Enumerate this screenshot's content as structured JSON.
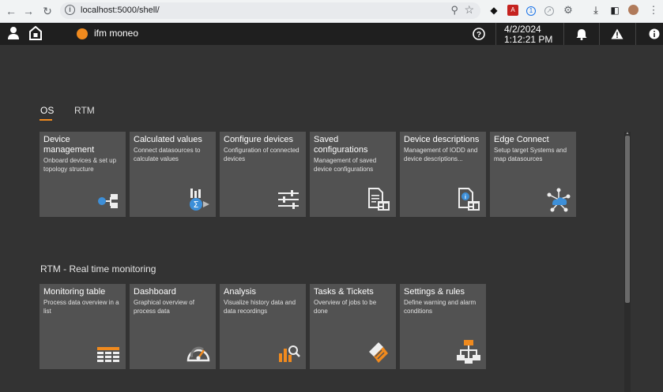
{
  "browser": {
    "url": "localhost:5000/shell/"
  },
  "header": {
    "brand": "ifm moneo",
    "date": "4/2/2024",
    "time": "1:12:21 PM"
  },
  "tabs": [
    {
      "label": "OS",
      "active": true
    },
    {
      "label": "RTM",
      "active": false
    }
  ],
  "os_tiles": [
    {
      "title": "Device management",
      "desc": "Onboard devices & set up topology structure",
      "icon": "device-topology-icon"
    },
    {
      "title": "Calculated values",
      "desc": "Connect datasources to calculate values",
      "icon": "calculator-sigma-icon"
    },
    {
      "title": "Configure devices",
      "desc": "Configuration of connected devices",
      "icon": "sliders-icon"
    },
    {
      "title": "Saved configurations",
      "desc": "Management of saved device configurations",
      "icon": "saved-config-icon"
    },
    {
      "title": "Device descriptions",
      "desc": "Management of IODD and device descriptions...",
      "icon": "device-description-icon"
    },
    {
      "title": "Edge Connect",
      "desc": "Setup target Systems and map datasources",
      "icon": "cloud-network-icon"
    }
  ],
  "rtm_section_title": "RTM - Real time monitoring",
  "rtm_tiles": [
    {
      "title": "Monitoring table",
      "desc": "Process data overview in a list",
      "icon": "table-icon"
    },
    {
      "title": "Dashboard",
      "desc": "Graphical overview of process data",
      "icon": "gauge-icon"
    },
    {
      "title": "Analysis",
      "desc": "Visualize history data and data recordings",
      "icon": "chart-search-icon"
    },
    {
      "title": "Tasks & Tickets",
      "desc": "Overview of jobs to be done",
      "icon": "tickets-icon"
    },
    {
      "title": "Settings & rules",
      "desc": "Define warning and alarm conditions",
      "icon": "hierarchy-icon"
    }
  ],
  "colors": {
    "accent": "#f08a1e",
    "icon_blue": "#3d8fd8",
    "tile_bg": "#525252",
    "page_bg": "#333333",
    "header_bg": "#1f1f1f"
  }
}
